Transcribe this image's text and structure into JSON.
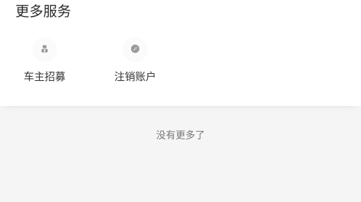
{
  "more_services": {
    "title": "更多服务",
    "items": [
      {
        "label": "车主招募",
        "icon": "driver-recruit-icon"
      },
      {
        "label": "注销账户",
        "icon": "compass-icon"
      }
    ]
  },
  "footer": {
    "no_more_text": "没有更多了"
  },
  "colors": {
    "background": "#f5f5f5",
    "card": "#ffffff",
    "icon": "#9a9a9a",
    "text": "#333333",
    "muted_text": "#777777"
  }
}
